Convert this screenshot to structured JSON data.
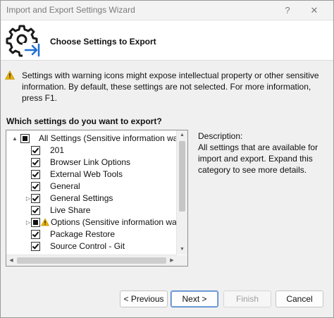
{
  "window": {
    "title": "Import and Export Settings Wizard",
    "help_glyph": "?",
    "close_glyph": "✕"
  },
  "header": {
    "title": "Choose Settings to Export",
    "icon": "gear-export-icon"
  },
  "warning": {
    "icon": "warning-triangle-icon",
    "text": "Settings with warning icons might expose intellectual property or other sensitive information. By default, these settings are not selected. For more information, press F1."
  },
  "tree": {
    "question": "Which settings do you want to export?",
    "items": [
      {
        "label": "All Settings (Sensitive information warning)",
        "state": "partial",
        "expander": "▲",
        "level": 0,
        "warning": false
      },
      {
        "label": "201",
        "state": "checked",
        "expander": "",
        "level": 1,
        "warning": false
      },
      {
        "label": "Browser Link Options",
        "state": "checked",
        "expander": "",
        "level": 1,
        "warning": false
      },
      {
        "label": "External Web Tools",
        "state": "checked",
        "expander": "",
        "level": 1,
        "warning": false
      },
      {
        "label": "General",
        "state": "checked",
        "expander": "",
        "level": 1,
        "warning": false
      },
      {
        "label": "General Settings",
        "state": "checked",
        "expander": "▷",
        "level": 1,
        "warning": false
      },
      {
        "label": "Live Share",
        "state": "checked",
        "expander": "",
        "level": 1,
        "warning": false
      },
      {
        "label": "Options (Sensitive information warning)",
        "state": "partial",
        "expander": "▷",
        "level": 1,
        "warning": true
      },
      {
        "label": "Package Restore",
        "state": "checked",
        "expander": "",
        "level": 1,
        "warning": false
      },
      {
        "label": "Source Control - Git",
        "state": "checked",
        "expander": "",
        "level": 1,
        "warning": false
      }
    ],
    "scroll_up_glyph": "▲",
    "scroll_down_glyph": "▼",
    "scroll_left_glyph": "◀",
    "scroll_right_glyph": "▶"
  },
  "description": {
    "label": "Description:",
    "text": "All settings that are available for import and export. Expand this category to see more details."
  },
  "buttons": {
    "previous": "< Previous",
    "next": "Next >",
    "finish": "Finish",
    "cancel": "Cancel"
  },
  "colors": {
    "warning_yellow": "#e8b100",
    "icon_blue": "#1f6fd1",
    "primary_border": "#4a7fc9"
  }
}
